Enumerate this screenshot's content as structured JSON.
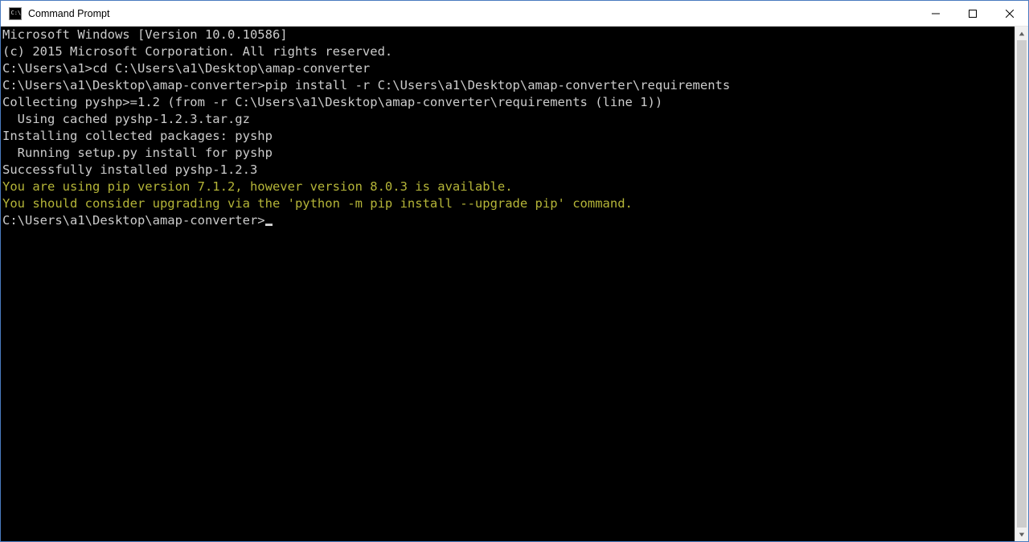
{
  "window": {
    "title": "Command Prompt"
  },
  "terminal": {
    "lines": [
      {
        "cls": "",
        "text": "Microsoft Windows [Version 10.0.10586]"
      },
      {
        "cls": "",
        "text": "(c) 2015 Microsoft Corporation. All rights reserved."
      },
      {
        "cls": "",
        "text": ""
      },
      {
        "cls": "",
        "text": "C:\\Users\\a1>cd C:\\Users\\a1\\Desktop\\amap-converter"
      },
      {
        "cls": "",
        "text": ""
      },
      {
        "cls": "",
        "text": "C:\\Users\\a1\\Desktop\\amap-converter>pip install -r C:\\Users\\a1\\Desktop\\amap-converter\\requirements"
      },
      {
        "cls": "",
        "text": "Collecting pyshp>=1.2 (from -r C:\\Users\\a1\\Desktop\\amap-converter\\requirements (line 1))"
      },
      {
        "cls": "",
        "text": "  Using cached pyshp-1.2.3.tar.gz"
      },
      {
        "cls": "",
        "text": "Installing collected packages: pyshp"
      },
      {
        "cls": "",
        "text": "  Running setup.py install for pyshp"
      },
      {
        "cls": "",
        "text": "Successfully installed pyshp-1.2.3"
      },
      {
        "cls": "warn",
        "text": "You are using pip version 7.1.2, however version 8.0.3 is available."
      },
      {
        "cls": "warn",
        "text": "You should consider upgrading via the 'python -m pip install --upgrade pip' command."
      },
      {
        "cls": "",
        "text": ""
      }
    ],
    "prompt": "C:\\Users\\a1\\Desktop\\amap-converter>"
  }
}
